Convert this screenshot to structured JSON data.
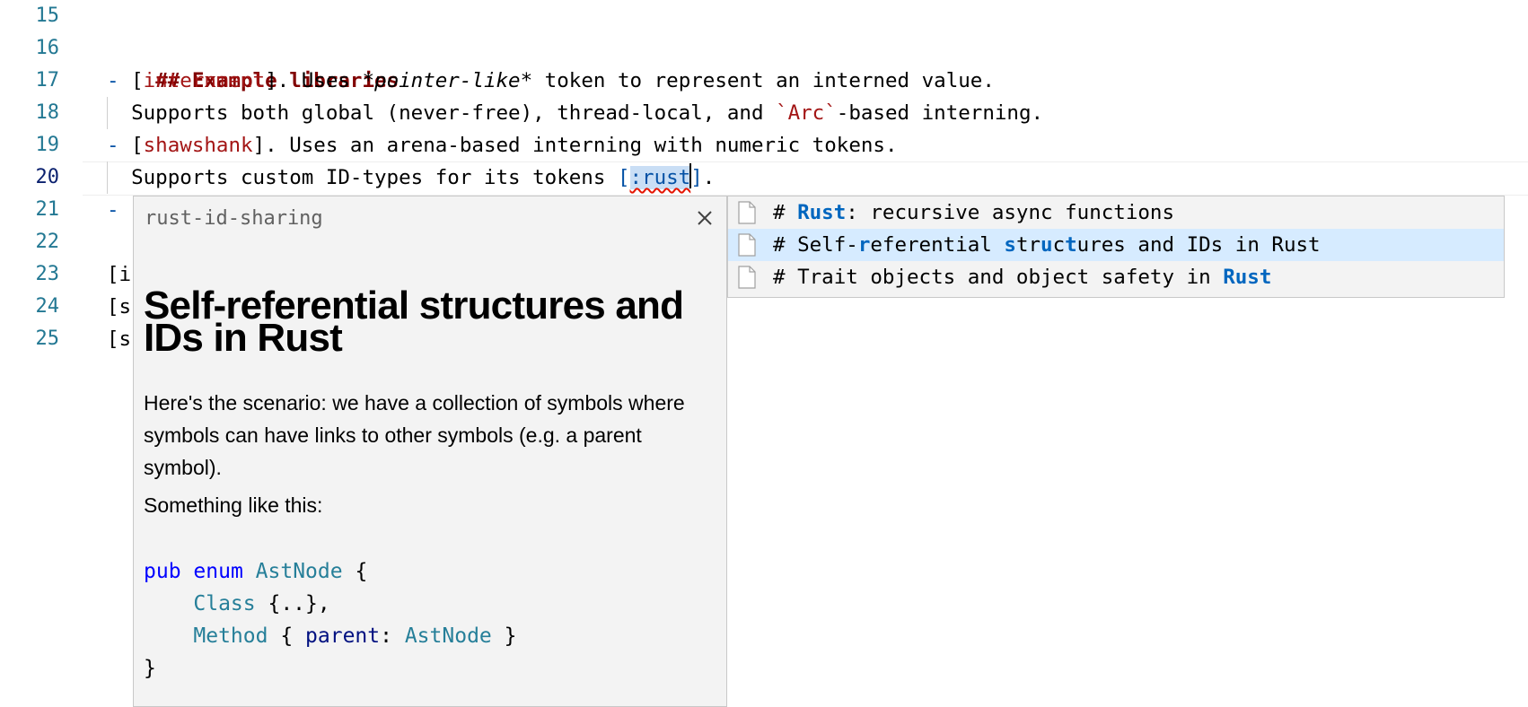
{
  "editor": {
    "line_numbers": [
      "15",
      "16",
      "17",
      "18",
      "19",
      "20",
      "21",
      "22",
      "23",
      "24",
      "25"
    ],
    "current_line": "20",
    "lines": {
      "l16": {
        "heading": "## Example libraries"
      },
      "l17": {
        "dash": "-",
        "open": " [",
        "link": "internment",
        "close": "]. Uses ",
        "em": "*pointer-like*",
        "rest": " token to represent an interned value."
      },
      "l18": {
        "pre": "  Supports both global (never-free), thread-local, and ",
        "code": "`Arc`",
        "rest": "-based interning."
      },
      "l19": {
        "dash": "-",
        "open": " [",
        "link": "shawshank",
        "rest": "]. Uses an arena-based interning with numeric tokens."
      },
      "l20": {
        "pre": "  Supports custom ID-types for its tokens ",
        "bracket": "[",
        "typed": ":rust",
        "close": "]",
        "end": "."
      },
      "l21": {
        "dash": "-"
      },
      "l23": {
        "text": "[i"
      },
      "l24": {
        "text": "[s"
      },
      "l25": {
        "text": "[s"
      }
    }
  },
  "preview": {
    "title": "rust-id-sharing",
    "heading": "Self-referential structures and IDs in Rust",
    "paragraph1": "Here's the scenario: we have a collection of symbols where symbols can have links to other symbols (e.g. a parent symbol).",
    "paragraph2": "Something like this:",
    "code": {
      "l1": {
        "kw1": "pub",
        "kw2": "enum",
        "type": "AstNode",
        "rest": " {"
      },
      "l2": {
        "indent": "    ",
        "type": "Class",
        "rest": " {..},"
      },
      "l3": {
        "indent": "    ",
        "type": "Method",
        "mid": " { ",
        "field": "parent",
        "colon": ": ",
        "type2": "AstNode",
        "rest": " }"
      },
      "l4": {
        "text": "}"
      }
    }
  },
  "suggestions": {
    "items": [
      {
        "parts": [
          "# ",
          "Rust",
          ": recursive async functions"
        ],
        "hl": [
          false,
          true,
          false
        ]
      },
      {
        "parts": [
          "# Self-",
          "r",
          "eferential ",
          "s",
          "tr",
          "u",
          "c",
          "t",
          "ures and IDs in Rust"
        ],
        "hl": [
          false,
          true,
          false,
          true,
          false,
          true,
          false,
          true,
          false
        ]
      },
      {
        "parts": [
          "# Trait objects and object safety in ",
          "Rust"
        ],
        "hl": [
          false,
          true
        ]
      }
    ],
    "active_index": 1
  }
}
